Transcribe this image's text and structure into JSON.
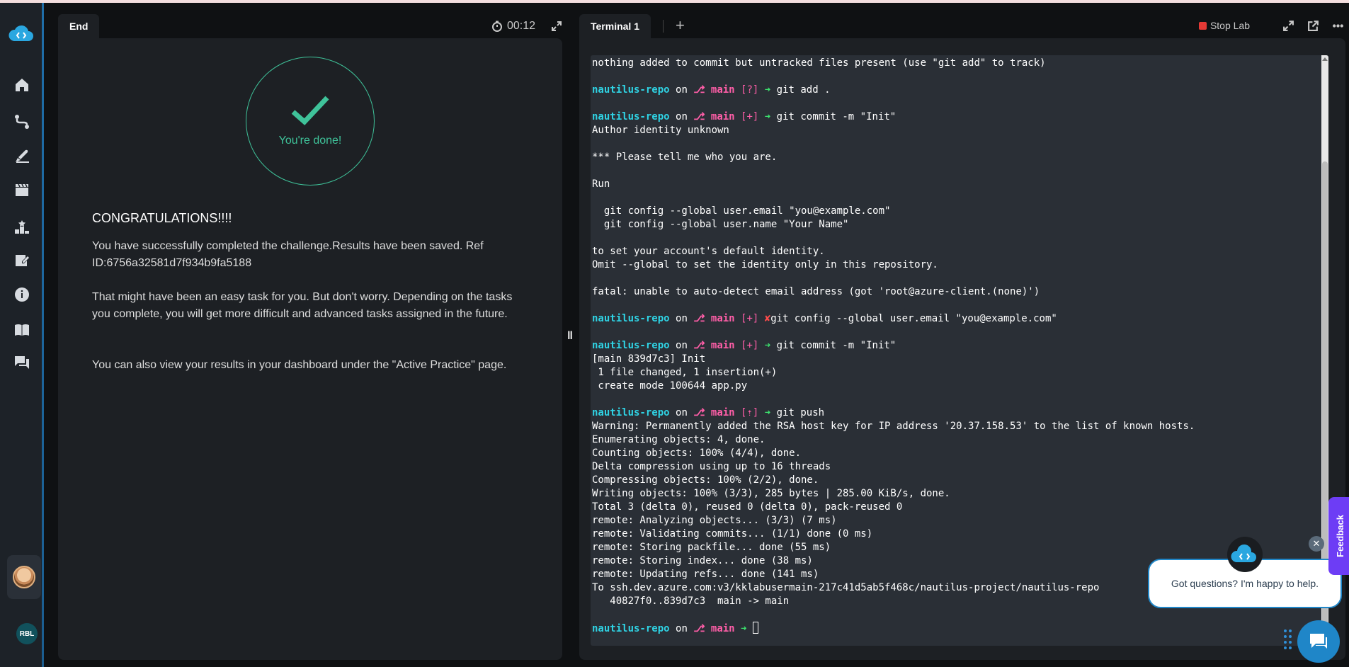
{
  "left_panel": {
    "tab_label": "End",
    "timer": "00:12",
    "done_text": "You're done!",
    "congrats": "CONGRATULATIONS!!!!",
    "paragraphs": [
      "You have successfully completed the challenge.Results have been saved. Ref ID:6756a32581d7f934b9fa5188",
      "That might have been an easy task for you. But don't worry. Depending on the tasks you complete, you will get more difficult and advanced tasks assigned in the future.",
      "You can also view your results in your dashboard under the \"Active Practice\" page."
    ]
  },
  "right_panel": {
    "tab_label": "Terminal 1",
    "add_tab": "+",
    "stop_label": "Stop Lab"
  },
  "nav": {
    "user_initials": "RBL",
    "icons": [
      "home-icon",
      "routes-icon",
      "rocket-icon",
      "clapper-icon",
      "ranking-icon",
      "notes-icon",
      "info-icon",
      "book-icon",
      "chat-icon"
    ]
  },
  "terminal": {
    "repo": "nautilus-repo",
    "on": "on",
    "branch_glyph": "⎇",
    "branch": "main",
    "arrow": "➜",
    "cross": "✘",
    "lines": [
      {
        "t": "out",
        "s": "nothing added to commit but untracked files present (use \"git add\" to track)"
      },
      {
        "t": "blank",
        "s": ""
      },
      {
        "t": "prompt",
        "status": "[?]",
        "ok": true,
        "cmd": "git add ."
      },
      {
        "t": "blank",
        "s": ""
      },
      {
        "t": "prompt",
        "status": "[+]",
        "ok": true,
        "cmd": "git commit -m \"Init\""
      },
      {
        "t": "out",
        "s": "Author identity unknown"
      },
      {
        "t": "blank",
        "s": ""
      },
      {
        "t": "out",
        "s": "*** Please tell me who you are."
      },
      {
        "t": "blank",
        "s": ""
      },
      {
        "t": "out",
        "s": "Run"
      },
      {
        "t": "blank",
        "s": ""
      },
      {
        "t": "out",
        "s": "  git config --global user.email \"you@example.com\""
      },
      {
        "t": "out",
        "s": "  git config --global user.name \"Your Name\""
      },
      {
        "t": "blank",
        "s": ""
      },
      {
        "t": "out",
        "s": "to set your account's default identity."
      },
      {
        "t": "out",
        "s": "Omit --global to set the identity only in this repository."
      },
      {
        "t": "blank",
        "s": ""
      },
      {
        "t": "out",
        "s": "fatal: unable to auto-detect email address (got 'root@azure-client.(none)')"
      },
      {
        "t": "blank",
        "s": ""
      },
      {
        "t": "prompt",
        "status": "[+]",
        "ok": false,
        "cmd": "git config --global user.email \"you@example.com\""
      },
      {
        "t": "blank",
        "s": ""
      },
      {
        "t": "prompt",
        "status": "[+]",
        "ok": true,
        "cmd": "git commit -m \"Init\""
      },
      {
        "t": "out",
        "s": "[main 839d7c3] Init"
      },
      {
        "t": "out",
        "s": " 1 file changed, 1 insertion(+)"
      },
      {
        "t": "out",
        "s": " create mode 100644 app.py"
      },
      {
        "t": "blank",
        "s": ""
      },
      {
        "t": "prompt",
        "status": "[⇡]",
        "ok": true,
        "cmd": "git push"
      },
      {
        "t": "out",
        "s": "Warning: Permanently added the RSA host key for IP address '20.37.158.53' to the list of known hosts."
      },
      {
        "t": "out",
        "s": "Enumerating objects: 4, done."
      },
      {
        "t": "out",
        "s": "Counting objects: 100% (4/4), done."
      },
      {
        "t": "out",
        "s": "Delta compression using up to 16 threads"
      },
      {
        "t": "out",
        "s": "Compressing objects: 100% (2/2), done."
      },
      {
        "t": "out",
        "s": "Writing objects: 100% (3/3), 285 bytes | 285.00 KiB/s, done."
      },
      {
        "t": "out",
        "s": "Total 3 (delta 0), reused 0 (delta 0), pack-reused 0"
      },
      {
        "t": "out",
        "s": "remote: Analyzing objects... (3/3) (7 ms)"
      },
      {
        "t": "out",
        "s": "remote: Validating commits... (1/1) done (0 ms)"
      },
      {
        "t": "out",
        "s": "remote: Storing packfile... done (55 ms)"
      },
      {
        "t": "out",
        "s": "remote: Storing index... done (38 ms)"
      },
      {
        "t": "out",
        "s": "remote: Updating refs... done (141 ms)"
      },
      {
        "t": "out",
        "s": "To ssh.dev.azure.com:v3/kklabusermain-217c41d5ab5f468c/nautilus-project/nautilus-repo"
      },
      {
        "t": "out",
        "s": "   40827f0..839d7c3  main -> main"
      },
      {
        "t": "blank",
        "s": ""
      },
      {
        "t": "prompt",
        "status": "",
        "ok": true,
        "cmd": "",
        "cursor": true
      }
    ]
  },
  "chat": {
    "bubble_text": "Got questions? I'm happy to help.",
    "close": "✕",
    "feedback_label": "Feedback"
  },
  "colors": {
    "accent": "#1f86c8",
    "success": "#3fc39a",
    "repo": "#2fd3e4",
    "branch": "#ff5ea8",
    "ok_arrow": "#3ce26e",
    "error": "#ff4b4b",
    "stop": "#e53935",
    "feedback": "#6d3df5"
  }
}
